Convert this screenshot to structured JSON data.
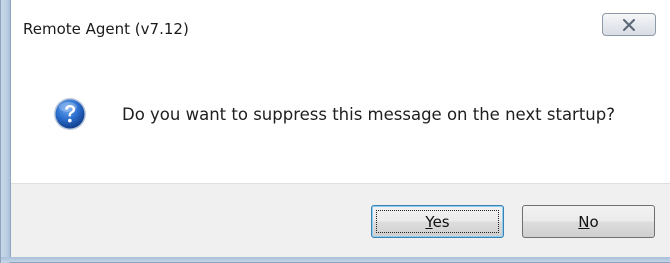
{
  "window": {
    "title": "Remote Agent (v7.12)"
  },
  "dialog": {
    "icon": "question-icon",
    "message": "Do you want to suppress this message on the next startup?"
  },
  "buttons": {
    "yes": {
      "mnemonic": "Y",
      "rest": "es"
    },
    "no": {
      "mnemonic": "N",
      "rest": "o"
    }
  },
  "colors": {
    "button_bar": "#f0f0f0",
    "default_button_border": "#3c7fb1",
    "icon_blue": "#1f5fb8"
  }
}
